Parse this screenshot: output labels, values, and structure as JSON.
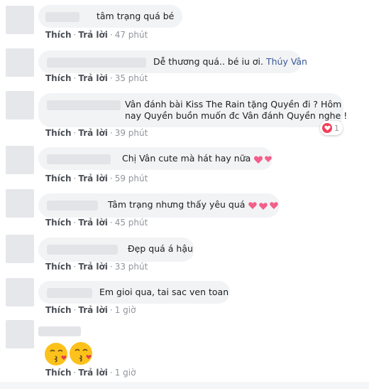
{
  "comments": [
    {
      "text": "tâm trạng quá bé",
      "like": "Thích",
      "reply": "Trả lời",
      "time": "47 phút"
    },
    {
      "text": "Dễ thương quá.. bé iu ơi. ",
      "mention": "Thúy Vân",
      "like": "Thích",
      "reply": "Trả lời",
      "time": "35 phút"
    },
    {
      "text_line1": "Vân đánh bài Kiss The Rain tặng Quyền đi ? Hôm",
      "text_line2": "nay Quyền buồn muốn đc Vân đánh Quyền nghe !",
      "reaction_count": "1",
      "like": "Thích",
      "reply": "Trả lời",
      "time": "39 phút"
    },
    {
      "text": "Chị Vân cute mà hát hay nữa",
      "like": "Thích",
      "reply": "Trả lời",
      "time": "59 phút"
    },
    {
      "text": "Tâm trạng nhưng thấy yêu quá ",
      "like": "Thích",
      "reply": "Trả lời",
      "time": "45 phút"
    },
    {
      "text": "Đẹp quá á hậu",
      "like": "Thích",
      "reply": "Trả lời",
      "time": "33 phút"
    },
    {
      "text": "Em gioi qua, tai sac ven toan",
      "like": "Thích",
      "reply": "Trả lời",
      "time": "1 giờ"
    },
    {
      "like": "Thích",
      "reply": "Trả lời",
      "time": "1 giờ"
    }
  ],
  "separator": "·",
  "colors": {
    "bubble": "#f2f3f5",
    "meta": "#90949c",
    "action": "#4b4f56",
    "link": "#385898",
    "heart": "#f33e58"
  },
  "icons": {
    "emoji": "pink-heart-emoji",
    "reaction": "heart-reaction-icon",
    "sticker": "kissing-face-sticker"
  }
}
